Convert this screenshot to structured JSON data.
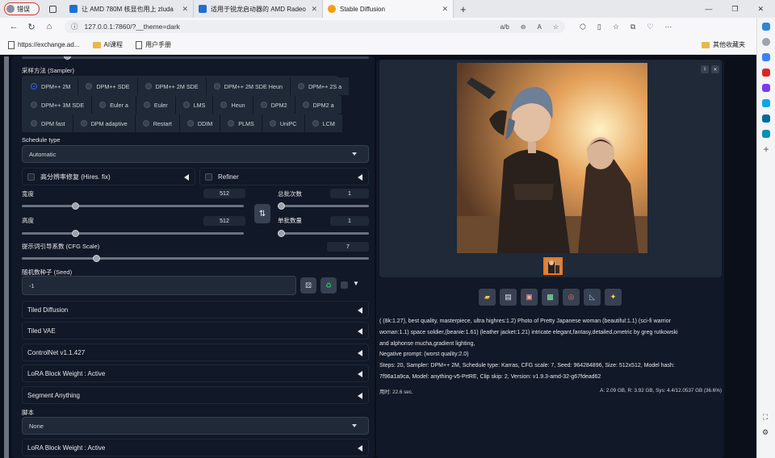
{
  "browser": {
    "profile_label": "错误",
    "tabs": [
      {
        "title": "让 AMD 780M 核显也用上 zluda",
        "icon_color": "#1f6fd1"
      },
      {
        "title": "适用于锐龙启动器的 AMD Radeo",
        "icon_color": "#1f6fd1"
      },
      {
        "title": "Stable Diffusion",
        "icon_color": "#f59e0b"
      }
    ],
    "url": "127.0.0.1:7860/?__theme=dark",
    "favorites": [
      {
        "label": "https://exchange.ad...",
        "icon": "doc-icon"
      },
      {
        "label": "AI课程",
        "icon": "folder-icon"
      },
      {
        "label": "用户手册",
        "icon": "doc-icon"
      }
    ],
    "other_favorites": "其他收藏夹"
  },
  "left": {
    "sampler_label": "采样方法 (Sampler)",
    "sampler_rows": [
      [
        "DPM++ 2M",
        "DPM++ SDE",
        "DPM++ 2M SDE",
        "DPM++ 2M SDE Heun",
        "DPM++ 2S a"
      ],
      [
        "DPM++ 3M SDE",
        "Euler a",
        "Euler",
        "LMS",
        "Heun",
        "DPM2",
        "DPM2 a"
      ],
      [
        "DPM fast",
        "DPM adaptive",
        "Restart",
        "DDIM",
        "PLMS",
        "UniPC",
        "LCM"
      ]
    ],
    "selected_sampler": "DPM++ 2M",
    "schedule_label": "Schedule type",
    "schedule_value": "Automatic",
    "hires_label": "高分辨率修复 (Hires. fix)",
    "refiner_label": "Refiner",
    "width_label": "宽度",
    "width_value": "512",
    "height_label": "高度",
    "height_value": "512",
    "batch_count_label": "总批次数",
    "batch_count_value": "1",
    "batch_size_label": "单批数量",
    "batch_size_value": "1",
    "cfg_label": "提示词引导系数 (CFG Scale)",
    "cfg_value": "7",
    "seed_label": "随机数种子 (Seed)",
    "seed_value": "-1",
    "accordions": [
      "Tiled Diffusion",
      "Tiled VAE",
      "ControlNet v1.1.427",
      "LoRA Block Weight : Active",
      "Segment Anything"
    ],
    "script_label": "脚本",
    "script_value": "None",
    "last_accordion": "LoRA Block Weight : Active"
  },
  "right": {
    "info_lines": [
      "( (8k:1.27), best quality, masterpiece, ultra highres:1.2) Photo of Pretty Japanese woman (beautiful:1.1) (sci-fi warrior",
      "woman:1.1) space soldier,(beanie:1.61) (leather jacket:1.21) intricate elegant,fantasy,detailed,ometric by greg rutkowski",
      "and alphonse mucha,gradient lighting,",
      "Negative prompt: (worst quality:2.0)",
      "Steps: 20, Sampler: DPM++ 2M, Schedule type: Karras, CFG scale: 7, Seed: 964284896, Size: 512x512, Model hash:",
      "7f96a1a9ca, Model: anything-v5-PrtRE, Clip skip: 2, Version: v1.9.3-amd-32-g67fdead62"
    ],
    "time_text": "用时: 22.6 sec.",
    "vram_text": "A: 2.09 GB, R: 3.92 GB, Sys: 4.4/12.0537 GB (36.6%)"
  }
}
